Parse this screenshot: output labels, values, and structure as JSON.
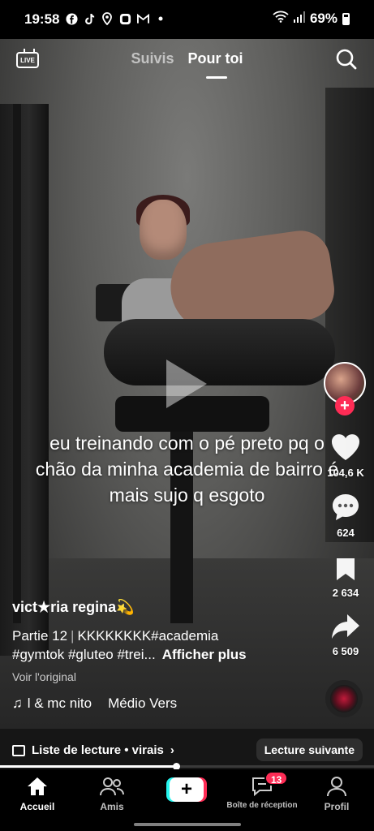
{
  "status_bar": {
    "time": "19:58",
    "battery": "69%",
    "notification_icons": [
      "facebook-icon",
      "tiktok-icon",
      "location-icon",
      "messenger-icon",
      "gmail-icon",
      "dot-icon"
    ]
  },
  "top_bar": {
    "live_label": "LIVE",
    "tabs": [
      {
        "label": "Suivis",
        "active": false
      },
      {
        "label": "Pour toi",
        "active": true
      }
    ]
  },
  "video": {
    "overlay_text": "eu treinando com o pé preto pq o chão da minha academia de bairro é mais sujo q esgoto",
    "state": "paused"
  },
  "rail": {
    "likes": "104,6 K",
    "comments": "624",
    "saves": "2 634",
    "shares": "6 509",
    "follow_symbol": "+"
  },
  "post": {
    "username": "vict★ria regina💫",
    "part": "Partie 12",
    "caption_line1": "KKKKKKKK#academia",
    "caption_line2": "#gymtok #gluteo #trei...",
    "see_more": "Afficher plus",
    "see_original": "Voir l'original",
    "sound_artist": "l & mc nito",
    "sound_title": "Médio Vers"
  },
  "playlist": {
    "label": "Liste de lecture • virais",
    "chevron": "›",
    "next_label": "Lecture suivante",
    "progress": 0.47
  },
  "nav": {
    "home": "Accueil",
    "friends": "Amis",
    "create": "+",
    "inbox": "Boîte de réception",
    "inbox_badge": "13",
    "profile": "Profil"
  },
  "colors": {
    "accent_red": "#fe2c55",
    "accent_cyan": "#25f4ee"
  }
}
